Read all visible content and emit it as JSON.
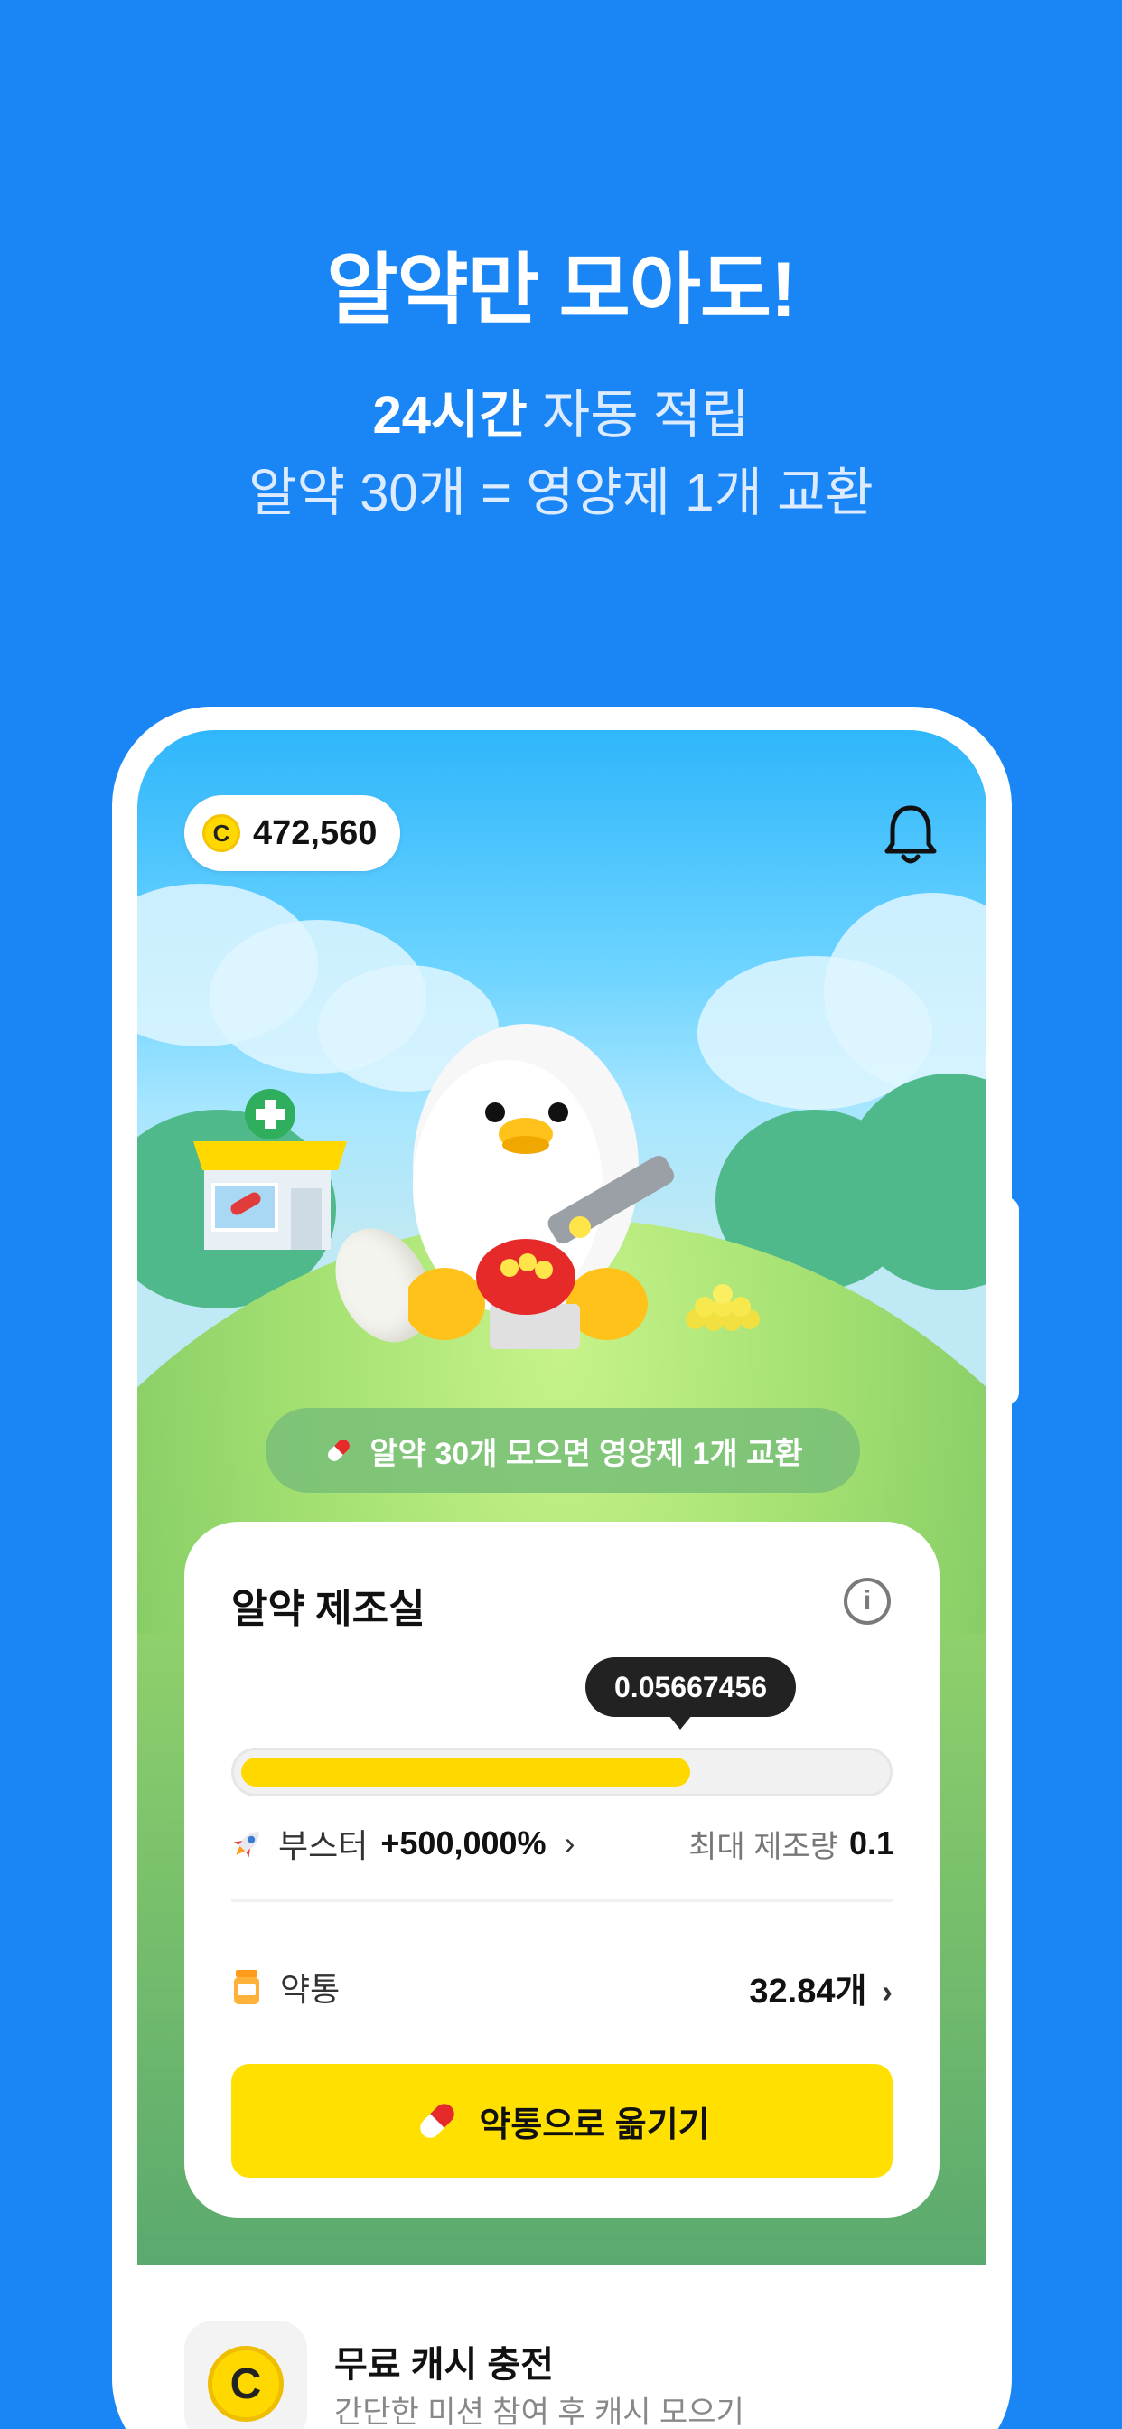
{
  "promo": {
    "headline": "알약만 모아도!",
    "sub_strong": "24시간",
    "sub_rest": " 자동 적립",
    "sub2": "알약 30개 = 영양제 1개 교환"
  },
  "header": {
    "cash_amount": "472,560",
    "coin_letter": "C"
  },
  "banner": {
    "text": "알약 30개 모으면 영양제 1개 교환"
  },
  "lab_card": {
    "title": "알약 제조실",
    "info_symbol": "i",
    "progress_value": "0.05667456",
    "progress_fraction": 0.7,
    "booster_label": "부스터",
    "booster_value": "+500,000%",
    "max_label": "최대 제조량",
    "max_value": "0.1",
    "bottle_label": "약통",
    "bottle_value": "32.84개",
    "move_button": "약통으로 옮기기"
  },
  "bottom_sheet": {
    "title": "무료 캐시 충전",
    "desc": "간단한 미션 참여 후 캐시 모으기",
    "coin_letter": "C"
  },
  "colors": {
    "background": "#1a86f5",
    "accent_yellow": "#ffe000",
    "progress_yellow": "#ffd800"
  }
}
